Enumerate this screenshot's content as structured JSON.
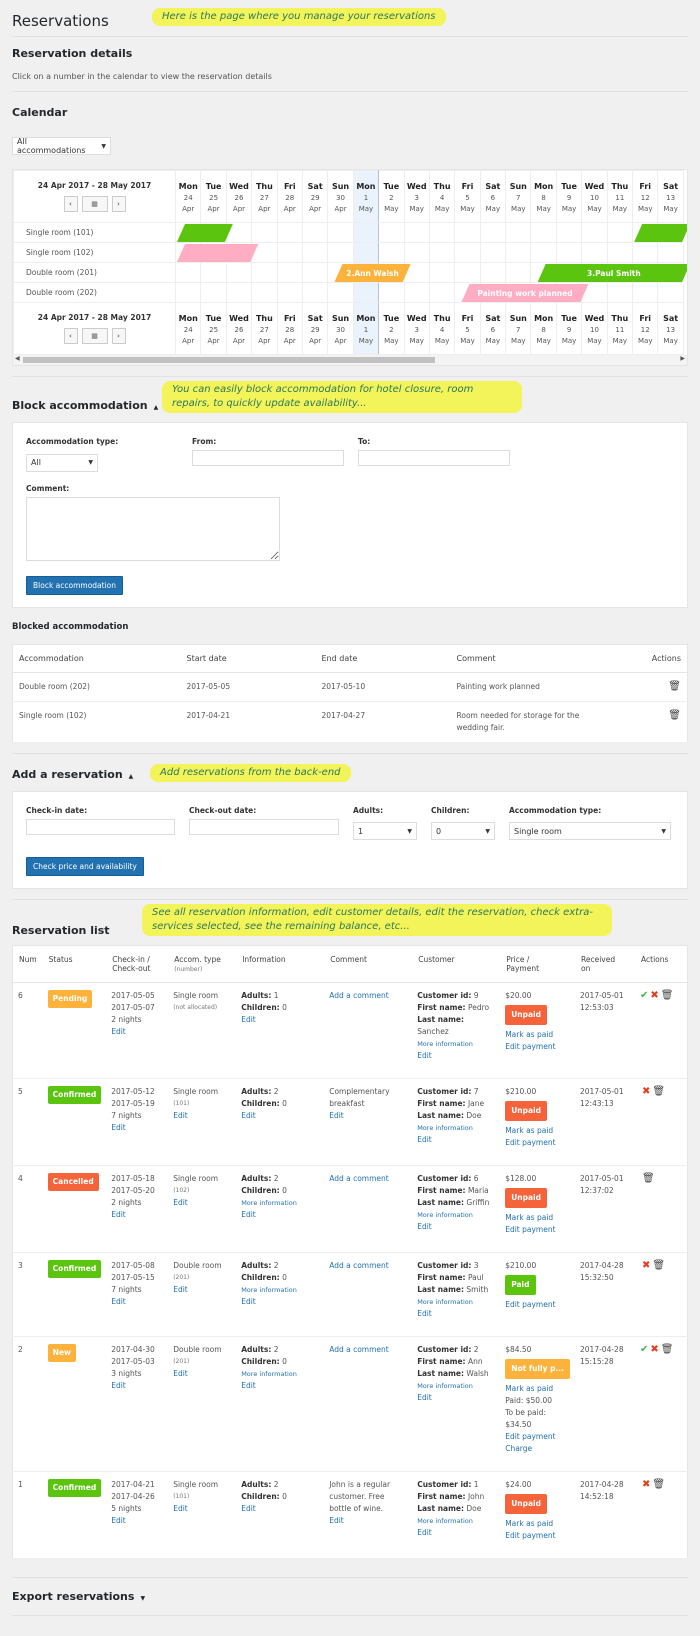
{
  "page": {
    "title": "Reservations",
    "note_main": "Here is the page where you manage your reservations"
  },
  "details": {
    "heading": "Reservation details",
    "hint": "Click on a number in the calendar to view the reservation details"
  },
  "calendar": {
    "heading": "Calendar",
    "filter_value": "All accommodations",
    "range": "24 Apr 2017 - 28 May 2017",
    "prev_icon": "‹",
    "next_icon": "›",
    "today_index": 7,
    "days": [
      {
        "dow": "Mon",
        "d": "24",
        "m": "Apr"
      },
      {
        "dow": "Tue",
        "d": "25",
        "m": "Apr"
      },
      {
        "dow": "Wed",
        "d": "26",
        "m": "Apr"
      },
      {
        "dow": "Thu",
        "d": "27",
        "m": "Apr"
      },
      {
        "dow": "Fri",
        "d": "28",
        "m": "Apr"
      },
      {
        "dow": "Sat",
        "d": "29",
        "m": "Apr"
      },
      {
        "dow": "Sun",
        "d": "30",
        "m": "Apr"
      },
      {
        "dow": "Mon",
        "d": "1",
        "m": "May"
      },
      {
        "dow": "Tue",
        "d": "2",
        "m": "May"
      },
      {
        "dow": "Wed",
        "d": "3",
        "m": "May"
      },
      {
        "dow": "Thu",
        "d": "4",
        "m": "May"
      },
      {
        "dow": "Fri",
        "d": "5",
        "m": "May"
      },
      {
        "dow": "Sat",
        "d": "6",
        "m": "May"
      },
      {
        "dow": "Sun",
        "d": "7",
        "m": "May"
      },
      {
        "dow": "Mon",
        "d": "8",
        "m": "May"
      },
      {
        "dow": "Tue",
        "d": "9",
        "m": "May"
      },
      {
        "dow": "Wed",
        "d": "10",
        "m": "May"
      },
      {
        "dow": "Thu",
        "d": "11",
        "m": "May"
      },
      {
        "dow": "Fri",
        "d": "12",
        "m": "May"
      },
      {
        "dow": "Sat",
        "d": "13",
        "m": "May"
      }
    ],
    "rooms": [
      "Single room (101)",
      "Single room (102)",
      "Double room (201)",
      "Double room (202)"
    ],
    "bookings": [
      {
        "room": 0,
        "start": 0,
        "end": 2.2,
        "label": "",
        "color": "green"
      },
      {
        "room": 0,
        "start": 18.0,
        "end": 20.2,
        "label": "",
        "color": "green"
      },
      {
        "room": 1,
        "start": 0,
        "end": 3.2,
        "label": "",
        "color": "pink"
      },
      {
        "room": 2,
        "start": 6.2,
        "end": 9.2,
        "label": "2.Ann Walsh",
        "color": "orange"
      },
      {
        "room": 2,
        "start": 14.2,
        "end": 20.2,
        "label": "3.Paul Smith",
        "color": "green"
      },
      {
        "room": 3,
        "start": 11.2,
        "end": 16.2,
        "label": "Painting work planned",
        "color": "pink"
      }
    ]
  },
  "block": {
    "heading": "Block accommodation",
    "note": "You can easily block accommodation for hotel closure, room repairs, to quickly update availability...",
    "type_label": "Accommodation type:",
    "type_value": "All",
    "from_label": "From:",
    "to_label": "To:",
    "comment_label": "Comment:",
    "button": "Block accommodation"
  },
  "blocked": {
    "heading": "Blocked accommodation",
    "columns": [
      "Accommodation",
      "Start date",
      "End date",
      "Comment",
      "Actions"
    ],
    "rows": [
      {
        "acc": "Double room (202)",
        "start": "2017-05-05",
        "end": "2017-05-10",
        "comment": "Painting work planned"
      },
      {
        "acc": "Single room (102)",
        "start": "2017-04-21",
        "end": "2017-04-27",
        "comment": "Room needed for storage for the wedding fair."
      }
    ]
  },
  "add": {
    "heading": "Add a reservation",
    "note": "Add reservations from the back-end",
    "checkin_label": "Check-in date:",
    "checkout_label": "Check-out date:",
    "adults_label": "Adults:",
    "adults_value": "1",
    "children_label": "Children:",
    "children_value": "0",
    "type_label": "Accommodation type:",
    "type_value": "Single room",
    "button": "Check price and availability"
  },
  "list": {
    "heading": "Reservation list",
    "note": "See all reservation information, edit customer details, edit the reservation, check extra-services selected, see the remaining balance, etc...",
    "columns": {
      "num": "Num",
      "status": "Status",
      "checkin": "Check-in /",
      "checkout": "Check-out",
      "accom": "Accom. type",
      "accom_sub": "(number)",
      "info": "Information",
      "comment": "Comment",
      "customer": "Customer",
      "price": "Price /",
      "payment": "Payment",
      "received": "Received",
      "received_on": "on",
      "actions": "Actions"
    },
    "labels": {
      "adults": "Adults:",
      "children": "Children:",
      "cust_id": "Customer id:",
      "first": "First name:",
      "last": "Last name:",
      "edit": "Edit",
      "more_info": "More information",
      "add_comment": "Add a comment",
      "mark_paid": "Mark as paid",
      "edit_payment": "Edit payment",
      "charge": "Charge"
    },
    "rows": [
      {
        "num": "6",
        "status": "Pending",
        "status_class": "b-pending",
        "checkin": "2017-05-05",
        "checkout": "2017-05-07",
        "nights": "2 nights",
        "accom": "Single room",
        "accom_num": "(not allocated)",
        "accom_edit": false,
        "adults": "1",
        "children": "0",
        "info_more": false,
        "comment": "",
        "cust_id": "9",
        "first": "Pedro",
        "last": "Sanchez",
        "price": "$20.00",
        "payment": "Unpaid",
        "payment_class": "b-unpaid",
        "mark_paid": true,
        "paid": "",
        "to_be_paid": "",
        "charge": false,
        "received_date": "2017-05-01",
        "received_time": "12:53:03",
        "confirm": true,
        "cancel": true
      },
      {
        "num": "5",
        "status": "Confirmed",
        "status_class": "b-confirmed",
        "checkin": "2017-05-12",
        "checkout": "2017-05-19",
        "nights": "7 nights",
        "accom": "Single room",
        "accom_num": "(101)",
        "accom_edit": true,
        "adults": "2",
        "children": "0",
        "info_more": false,
        "comment": "Complementary breakfast",
        "cust_id": "7",
        "first": "Jane",
        "last": "Doe",
        "price": "$210.00",
        "payment": "Unpaid",
        "payment_class": "b-unpaid",
        "mark_paid": true,
        "paid": "",
        "to_be_paid": "",
        "charge": false,
        "received_date": "2017-05-01",
        "received_time": "12:43:13",
        "confirm": false,
        "cancel": true
      },
      {
        "num": "4",
        "status": "Cancelled",
        "status_class": "b-cancelled",
        "checkin": "2017-05-18",
        "checkout": "2017-05-20",
        "nights": "2 nights",
        "accom": "Single room",
        "accom_num": "(102)",
        "accom_edit": true,
        "adults": "2",
        "children": "0",
        "info_more": true,
        "comment": "",
        "cust_id": "6",
        "first": "Maria",
        "last": "Griffin",
        "price": "$128.00",
        "payment": "Unpaid",
        "payment_class": "b-unpaid",
        "mark_paid": true,
        "paid": "",
        "to_be_paid": "",
        "charge": false,
        "received_date": "2017-05-01",
        "received_time": "12:37:02",
        "confirm": false,
        "cancel": false
      },
      {
        "num": "3",
        "status": "Confirmed",
        "status_class": "b-confirmed",
        "checkin": "2017-05-08",
        "checkout": "2017-05-15",
        "nights": "7 nights",
        "accom": "Double room",
        "accom_num": "(201)",
        "accom_edit": true,
        "adults": "2",
        "children": "0",
        "info_more": true,
        "comment": "",
        "cust_id": "3",
        "first": "Paul",
        "last": "Smith",
        "price": "$210.00",
        "payment": "Paid",
        "payment_class": "b-paid",
        "mark_paid": false,
        "paid": "",
        "to_be_paid": "",
        "charge": false,
        "received_date": "2017-04-28",
        "received_time": "15:32:50",
        "confirm": false,
        "cancel": true
      },
      {
        "num": "2",
        "status": "New",
        "status_class": "b-new",
        "checkin": "2017-04-30",
        "checkout": "2017-05-03",
        "nights": "3 nights",
        "accom": "Double room",
        "accom_num": "(201)",
        "accom_edit": true,
        "adults": "2",
        "children": "0",
        "info_more": true,
        "comment": "",
        "cust_id": "2",
        "first": "Ann",
        "last": "Walsh",
        "price": "$84.50",
        "payment": "Not fully p...",
        "payment_class": "b-notfully",
        "mark_paid": true,
        "paid": "Paid: $50.00",
        "to_be_paid": "To be paid: $34.50",
        "charge": true,
        "received_date": "2017-04-28",
        "received_time": "15:15:28",
        "confirm": true,
        "cancel": true
      },
      {
        "num": "1",
        "status": "Confirmed",
        "status_class": "b-confirmed",
        "checkin": "2017-04-21",
        "checkout": "2017-04-26",
        "nights": "5 nights",
        "accom": "Single room",
        "accom_num": "(101)",
        "accom_edit": true,
        "adults": "2",
        "children": "0",
        "info_more": false,
        "comment": "John is a regular customer. Free bottle of wine.",
        "cust_id": "1",
        "first": "John",
        "last": "Doe",
        "price": "$24.00",
        "payment": "Unpaid",
        "payment_class": "b-unpaid",
        "mark_paid": true,
        "paid": "",
        "to_be_paid": "",
        "charge": false,
        "received_date": "2017-04-28",
        "received_time": "14:52:18",
        "confirm": false,
        "cancel": true
      }
    ]
  },
  "export": {
    "heading": "Export reservations"
  },
  "icons": {
    "calendar": "calendar-icon",
    "trash": "trash-icon",
    "confirm": "check-icon",
    "cancel": "close-icon",
    "expand": "triangle-up-icon",
    "collapse": "triangle-down-icon"
  }
}
